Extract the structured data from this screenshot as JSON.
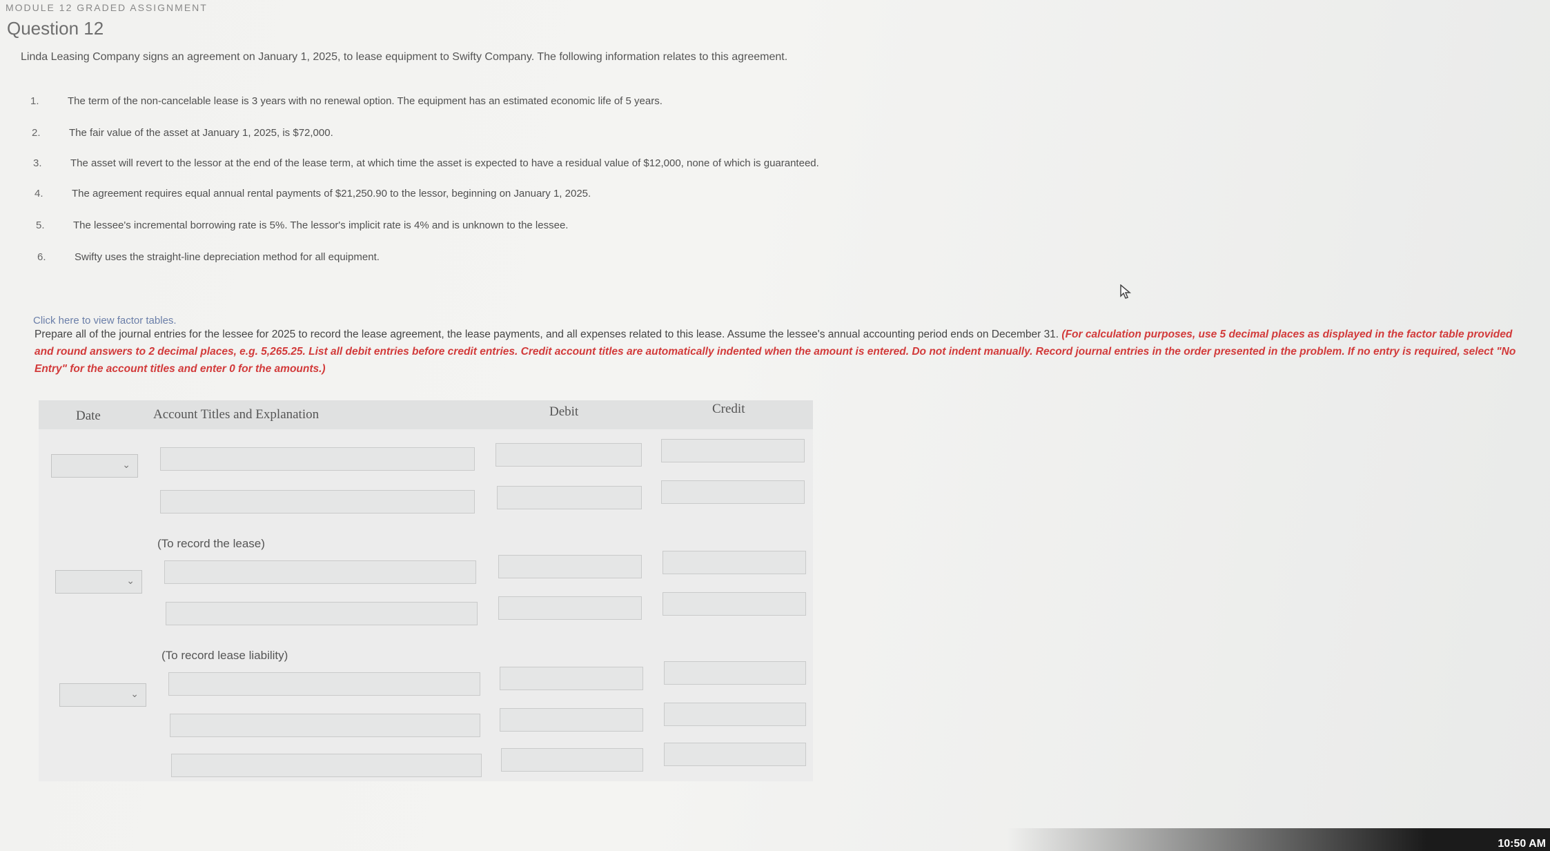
{
  "header": {
    "module_label": "MODULE 12 GRADED ASSIGNMENT",
    "question_title": "Question 12"
  },
  "intro": "Linda Leasing Company signs an agreement on January 1, 2025, to lease equipment to Swifty Company. The following information relates to this agreement.",
  "items": [
    {
      "num": "1.",
      "text": "The term of the non-cancelable lease is 3 years with no renewal option. The equipment has an estimated economic life of 5 years."
    },
    {
      "num": "2.",
      "text": "The fair value of the asset at January 1, 2025, is $72,000."
    },
    {
      "num": "3.",
      "text": "The asset will revert to the lessor at the end of the lease term, at which time the asset is expected to have a residual value of $12,000, none of which is guaranteed."
    },
    {
      "num": "4.",
      "text": "The agreement requires equal annual rental payments of $21,250.90 to the lessor, beginning on January 1, 2025."
    },
    {
      "num": "5.",
      "text": "The lessee's incremental borrowing rate is 5%. The lessor's implicit rate is 4% and is unknown to the lessee."
    },
    {
      "num": "6.",
      "text": "Swifty uses the straight-line depreciation method for all equipment."
    }
  ],
  "factor_link": "Click here to view factor tables.",
  "instructions": {
    "plain": "Prepare all of the journal entries for the lessee for 2025 to record the lease agreement, the lease payments, and all expenses related to this lease. Assume the lessee's annual accounting period ends on December 31. ",
    "red": "(For calculation purposes, use 5 decimal places as displayed in the factor table provided and round answers to 2 decimal places, e.g. 5,265.25. List all debit entries before credit entries. Credit account titles are automatically indented when the amount is entered. Do not indent manually. Record journal entries in the order presented in the problem. If no entry is required, select \"No Entry\" for the account titles and enter 0 for the amounts.)"
  },
  "table": {
    "headers": {
      "date": "Date",
      "account": "Account Titles and Explanation",
      "debit": "Debit",
      "credit": "Credit"
    },
    "entries": [
      {
        "date": "",
        "memo": "(To record the lease)",
        "rows": 2
      },
      {
        "date": "",
        "memo": "(To record lease liability)",
        "rows": 2
      },
      {
        "date": "",
        "memo": "",
        "rows": 3
      }
    ]
  },
  "taskbar": {
    "clock": "10:50 AM"
  },
  "icons": {
    "dropdown": "chevron-down-icon",
    "cursor": "mouse-pointer-icon"
  }
}
